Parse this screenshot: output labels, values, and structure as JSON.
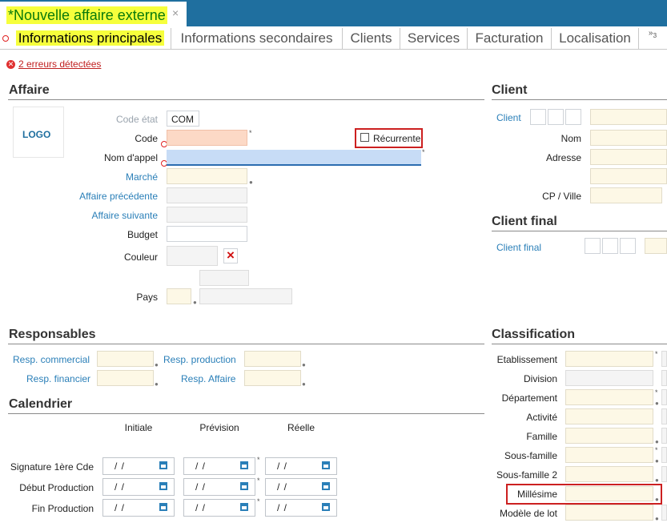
{
  "document": {
    "title": "Nouvelle affaire externe",
    "modified_marker": "*",
    "close_glyph": "×"
  },
  "tabs": {
    "items": [
      "Informations principales",
      "Informations secondaires",
      "Clients",
      "Services",
      "Facturation",
      "Localisation"
    ],
    "active_index": 0,
    "overflow_label": "»",
    "overflow_count": "3"
  },
  "errors": {
    "icon": "error-circle-icon",
    "link_text": "2 erreurs détectées"
  },
  "affaire": {
    "section_title": "Affaire",
    "logo_text": "LOGO",
    "code_etat_label": "Code état",
    "code_etat_value": "COM",
    "code_label": "Code",
    "recurrente_label": "Récurrente",
    "nom_appel_label": "Nom d'appel",
    "marche_label": "Marché",
    "affaire_precedente_label": "Affaire précédente",
    "affaire_suivante_label": "Affaire suivante",
    "budget_label": "Budget",
    "couleur_label": "Couleur",
    "clear_color_glyph": "×",
    "pays_label": "Pays"
  },
  "client": {
    "section_title": "Client",
    "client_label": "Client",
    "nom_label": "Nom",
    "adresse_label": "Adresse",
    "cp_ville_label": "CP / Ville"
  },
  "client_final": {
    "section_title": "Client final",
    "client_final_label": "Client final"
  },
  "responsables": {
    "section_title": "Responsables",
    "resp_commercial_label": "Resp. commercial",
    "resp_production_label": "Resp. production",
    "resp_financier_label": "Resp. financier",
    "resp_affaire_label": "Resp. Affaire"
  },
  "calendrier": {
    "section_title": "Calendrier",
    "columns": [
      "Initiale",
      "Prévision",
      "Réelle"
    ],
    "rows": [
      {
        "label": "Signature 1ère Cde",
        "dates": [
          "/ /",
          "/ /",
          "/ /"
        ]
      },
      {
        "label": "Début Production",
        "dates": [
          "/ /",
          "/ /",
          "/ /"
        ]
      },
      {
        "label": "Fin Production",
        "dates": [
          "/ /",
          "/ /",
          "/ /"
        ]
      }
    ]
  },
  "classification": {
    "section_title": "Classification",
    "items": [
      "Etablissement",
      "Division",
      "Département",
      "Activité",
      "Famille",
      "Sous-famille",
      "Sous-famille 2",
      "Millésime",
      "Modèle de lot"
    ]
  },
  "colors": {
    "accent_bar": "#1f6f9f",
    "highlight": "#f6ff3c",
    "error": "#cc2020",
    "link_blue": "#2a7fb8",
    "mandatory_field": "#fcd9c6",
    "focused_field": "#c7dcf6",
    "optional_field": "#fdf8e6"
  }
}
